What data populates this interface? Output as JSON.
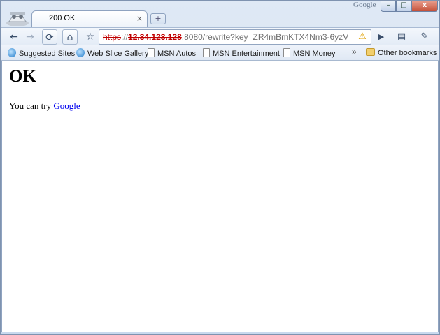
{
  "window": {
    "brand": "Google",
    "tab_title": "200 OK",
    "tab_close": "×",
    "new_tab": "+",
    "minimize": "–",
    "maximize": "□",
    "close": "x"
  },
  "toolbar": {
    "url_scheme": "https",
    "url_separator": "://",
    "url_host": "12.34.123.128",
    "url_rest": ":8080/rewrite?key=ZR4mBmKTX4Nm3-6yzV",
    "back_icon": "←",
    "forward_icon": "→",
    "reload_icon": "⟳",
    "home_icon": "⌂",
    "star_icon": "☆",
    "warning_icon": "⚠",
    "go_icon": "▶",
    "page_menu_icon": "▤",
    "tools_menu_icon": "✎"
  },
  "bookmarks": {
    "items": [
      {
        "label": "Suggested Sites"
      },
      {
        "label": "Web Slice Gallery"
      },
      {
        "label": "MSN Autos"
      },
      {
        "label": "MSN Entertainment"
      },
      {
        "label": "MSN Money"
      }
    ],
    "overflow": "»",
    "other": "Other bookmarks"
  },
  "page": {
    "heading": "OK",
    "text_prefix": "You can try ",
    "link_text": "Google"
  },
  "colors": {
    "link": "#0000ee",
    "insecure_url": "#c00000",
    "warning": "#e0a000"
  }
}
